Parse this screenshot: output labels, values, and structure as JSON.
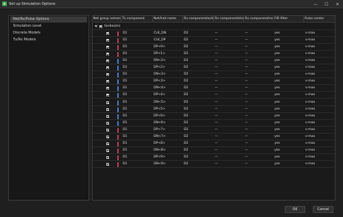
{
  "window": {
    "title": "Set up Simulation Options"
  },
  "window_controls": {
    "minimize": "—",
    "maximize": "☐",
    "close": "✕"
  },
  "nav": {
    "items": [
      {
        "label": "Net/Rx/Pulse Options",
        "selected": true
      },
      {
        "label": "Simulation Level",
        "selected": false
      },
      {
        "label": "Discrete Models",
        "selected": false
      },
      {
        "label": "Tx/Rx Models",
        "selected": false
      }
    ]
  },
  "grid": {
    "columns": [
      "Net group names",
      "Tx component",
      "Net/Inet name",
      "Rx component/active",
      "Rx component/stand",
      "Rx component/not",
      "FIR filter",
      "Pulse center"
    ],
    "group": {
      "name": "Serdes/mi..."
    },
    "rows": [
      {
        "tx": "D1",
        "net": "CLK_DN",
        "rx_active": "D2",
        "rx_stand": "—",
        "rx_not": "—",
        "fir": "yes",
        "pulse": "v-max",
        "bar_color": "#c0405a"
      },
      {
        "tx": "D1",
        "net": "CLK_DP",
        "rx_active": "D2",
        "rx_stand": "—",
        "rx_not": "—",
        "fir": "yes",
        "pulse": "v-max",
        "bar_color": "#c0405a"
      },
      {
        "tx": "D1",
        "net": "DP<0>",
        "rx_active": "D2",
        "rx_stand": "—",
        "rx_not": "—",
        "fir": "yes",
        "pulse": "v-max",
        "bar_color": "#c0405a"
      },
      {
        "tx": "D1",
        "net": "DP<1>",
        "rx_active": "D2",
        "rx_stand": "—",
        "rx_not": "—",
        "fir": "yes",
        "pulse": "v-max",
        "bar_color": "#c0405a"
      },
      {
        "tx": "D1",
        "net": "DN<2>",
        "rx_active": "D2",
        "rx_stand": "—",
        "rx_not": "—",
        "fir": "yes",
        "pulse": "v-max",
        "bar_color": "#4a7fd0"
      },
      {
        "tx": "D1",
        "net": "DP<2>",
        "rx_active": "D2",
        "rx_stand": "—",
        "rx_not": "—",
        "fir": "yes",
        "pulse": "v-max",
        "bar_color": "#4a7fd0"
      },
      {
        "tx": "D1",
        "net": "DN<3>",
        "rx_active": "D2",
        "rx_stand": "—",
        "rx_not": "—",
        "fir": "yes",
        "pulse": "v-max",
        "bar_color": "#4a7fd0"
      },
      {
        "tx": "D1",
        "net": "DP<3>",
        "rx_active": "D2",
        "rx_stand": "—",
        "rx_not": "—",
        "fir": "yes",
        "pulse": "v-max",
        "bar_color": "#4a7fd0"
      },
      {
        "tx": "D1",
        "net": "DN<4>",
        "rx_active": "D2",
        "rx_stand": "—",
        "rx_not": "—",
        "fir": "yes",
        "pulse": "v-max",
        "bar_color": "#4a7fd0"
      },
      {
        "tx": "D1",
        "net": "DP<4>",
        "rx_active": "D2",
        "rx_stand": "—",
        "rx_not": "—",
        "fir": "yes",
        "pulse": "v-max",
        "bar_color": "#4a7fd0"
      },
      {
        "tx": "D1",
        "net": "DN<5>",
        "rx_active": "D2",
        "rx_stand": "—",
        "rx_not": "—",
        "fir": "yes",
        "pulse": "v-max",
        "bar_color": "#4a7fd0"
      },
      {
        "tx": "D1",
        "net": "DP<5>",
        "rx_active": "D2",
        "rx_stand": "—",
        "rx_not": "—",
        "fir": "yes",
        "pulse": "v-max",
        "bar_color": "#4a7fd0"
      },
      {
        "tx": "D1",
        "net": "DP<6>",
        "rx_active": "D2",
        "rx_stand": "—",
        "rx_not": "—",
        "fir": "yes",
        "pulse": "v-max",
        "bar_color": "#4a7fd0"
      },
      {
        "tx": "D1",
        "net": "DN<6>",
        "rx_active": "D2",
        "rx_stand": "—",
        "rx_not": "—",
        "fir": "yes",
        "pulse": "v-max",
        "bar_color": "#4a7fd0"
      },
      {
        "tx": "D1",
        "net": "DP<7>",
        "rx_active": "D2",
        "rx_stand": "—",
        "rx_not": "—",
        "fir": "yes",
        "pulse": "v-max",
        "bar_color": "#c0405a"
      },
      {
        "tx": "D1",
        "net": "DN<7>",
        "rx_active": "D2",
        "rx_stand": "—",
        "rx_not": "—",
        "fir": "yes",
        "pulse": "v-max",
        "bar_color": "#c0405a"
      },
      {
        "tx": "D1",
        "net": "DP<8>",
        "rx_active": "D2",
        "rx_stand": "—",
        "rx_not": "—",
        "fir": "yes",
        "pulse": "v-max",
        "bar_color": "#c0405a"
      },
      {
        "tx": "D1",
        "net": "DN<8>",
        "rx_active": "D2",
        "rx_stand": "—",
        "rx_not": "—",
        "fir": "yes",
        "pulse": "v-max",
        "bar_color": "#c0405a"
      },
      {
        "tx": "D1",
        "net": "DP<9>",
        "rx_active": "D2",
        "rx_stand": "—",
        "rx_not": "—",
        "fir": "yes",
        "pulse": "v-max",
        "bar_color": "#c0405a"
      },
      {
        "tx": "D1",
        "net": "DN<9>",
        "rx_active": "D2",
        "rx_stand": "—",
        "rx_not": "—",
        "fir": "yes",
        "pulse": "v-max",
        "bar_color": "#c0405a"
      }
    ]
  },
  "buttons": {
    "ok": "OK",
    "cancel": "Cancel"
  }
}
